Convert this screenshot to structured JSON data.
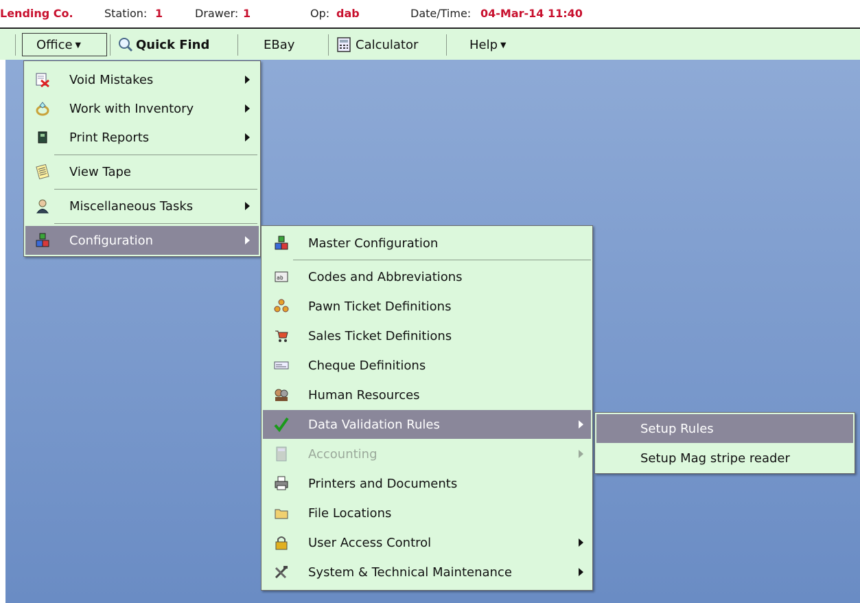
{
  "status": {
    "company": "Lending Co.",
    "station_label": "Station:",
    "station_value": "1",
    "drawer_label": "Drawer:",
    "drawer_value": "1",
    "op_label": "Op:",
    "op_value": "dab",
    "datetime_label": "Date/Time:",
    "datetime_value": "04-Mar-14 11:40"
  },
  "toolbar": {
    "office": "Office",
    "quick_find": "Quick Find",
    "ebay": "EBay",
    "calculator": "Calculator",
    "help": "Help"
  },
  "office_menu": [
    {
      "label": "Void Mistakes",
      "icon": "void-icon",
      "submenu": true
    },
    {
      "label": "Work with Inventory",
      "icon": "ring-icon",
      "submenu": true
    },
    {
      "label": "Print Reports",
      "icon": "report-book-icon",
      "submenu": true
    },
    {
      "label": "View Tape",
      "icon": "tape-icon",
      "submenu": false
    },
    {
      "label": "Miscellaneous Tasks",
      "icon": "person-icon",
      "submenu": true
    },
    {
      "label": "Configuration",
      "icon": "blocks-icon",
      "submenu": true,
      "highlighted": true
    }
  ],
  "config_menu": [
    {
      "label": "Master Configuration",
      "icon": "blocks-icon"
    },
    {
      "label": "Codes and Abbreviations",
      "icon": "codes-icon"
    },
    {
      "label": "Pawn Ticket Definitions",
      "icon": "pawn-icon"
    },
    {
      "label": "Sales Ticket Definitions",
      "icon": "cart-icon"
    },
    {
      "label": "Cheque Definitions",
      "icon": "cheque-icon"
    },
    {
      "label": "Human Resources",
      "icon": "people-icon"
    },
    {
      "label": "Data Validation Rules",
      "icon": "checkmark-icon",
      "highlighted": true,
      "submenu": true
    },
    {
      "label": "Accounting",
      "icon": "calculator-icon",
      "disabled": true,
      "submenu": true
    },
    {
      "label": "Printers and Documents",
      "icon": "printer-icon"
    },
    {
      "label": "File Locations",
      "icon": "folder-icon"
    },
    {
      "label": "User Access Control",
      "icon": "lock-icon",
      "submenu": true
    },
    {
      "label": "System & Technical Maintenance",
      "icon": "tools-icon",
      "submenu": true
    }
  ],
  "validation_menu": [
    {
      "label": "Setup Rules",
      "highlighted": true
    },
    {
      "label": "Setup Mag stripe reader"
    }
  ],
  "colors": {
    "menu_bg": "#dcf8dc",
    "highlight": "#8a879a",
    "status_red": "#c8102e",
    "desktop_top": "#8eaad6",
    "desktop_bottom": "#6a8cc4"
  }
}
